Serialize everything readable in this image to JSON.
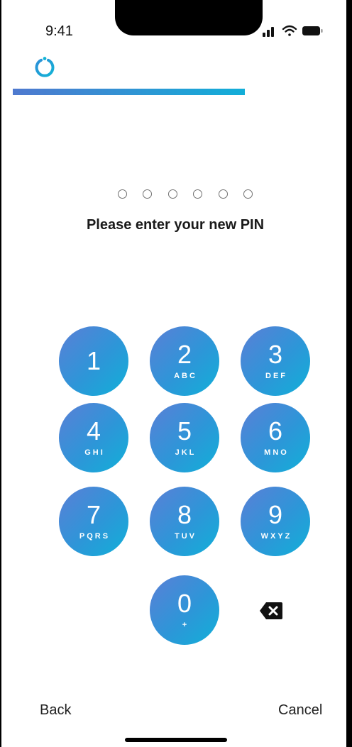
{
  "status_bar": {
    "time": "9:41"
  },
  "onboarding": {
    "progress": 0.69
  },
  "pin": {
    "length": 6,
    "entered": 0,
    "prompt": "Please enter your new PIN"
  },
  "keypad": [
    {
      "digit": "1",
      "letters": ""
    },
    {
      "digit": "2",
      "letters": "ABC"
    },
    {
      "digit": "3",
      "letters": "DEF"
    },
    {
      "digit": "4",
      "letters": "GHI"
    },
    {
      "digit": "5",
      "letters": "JKL"
    },
    {
      "digit": "6",
      "letters": "MNO"
    },
    {
      "digit": "7",
      "letters": "PQRS"
    },
    {
      "digit": "8",
      "letters": "TUV"
    },
    {
      "digit": "9",
      "letters": "WXYZ"
    },
    {
      "digit": "0",
      "letters": "+"
    }
  ],
  "footer": {
    "back_label": "Back",
    "cancel_label": "Cancel"
  },
  "colors": {
    "accent_start": "#4f79cf",
    "accent_end": "#12aed8"
  },
  "icons": {
    "logo": "ring-logo-icon",
    "backspace": "backspace-icon"
  }
}
